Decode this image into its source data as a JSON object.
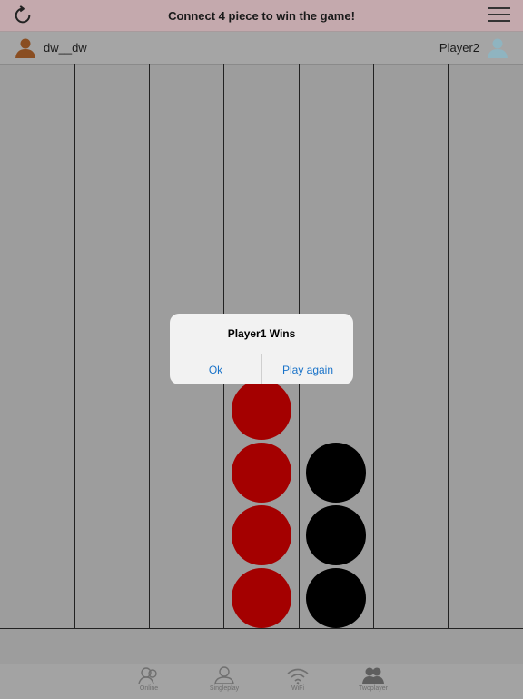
{
  "header": {
    "title": "Connect 4 piece to win the game!"
  },
  "players": {
    "player1_name": "dw__dw",
    "player2_name": "Player2"
  },
  "board": {
    "columns": 7,
    "rows": 9,
    "pieces": [
      {
        "column": 4,
        "row": 1,
        "color": "red"
      },
      {
        "column": 4,
        "row": 2,
        "color": "red"
      },
      {
        "column": 4,
        "row": 3,
        "color": "red"
      },
      {
        "column": 4,
        "row": 4,
        "color": "red"
      },
      {
        "column": 5,
        "row": 1,
        "color": "black"
      },
      {
        "column": 5,
        "row": 2,
        "color": "black"
      },
      {
        "column": 5,
        "row": 3,
        "color": "black"
      }
    ]
  },
  "dialog": {
    "title": "Player1 Wins",
    "ok_label": "Ok",
    "play_again_label": "Play again"
  },
  "tabbar": {
    "tabs": [
      {
        "label": "Online",
        "icon": "online-icon"
      },
      {
        "label": "Singleplay",
        "icon": "person-icon"
      },
      {
        "label": "WiFi",
        "icon": "wifi-icon"
      },
      {
        "label": "Twoplayer",
        "icon": "two-players-icon"
      }
    ]
  },
  "colors": {
    "red_piece": "#a40000",
    "black_piece": "#000000",
    "link_blue": "#1a73c9"
  }
}
